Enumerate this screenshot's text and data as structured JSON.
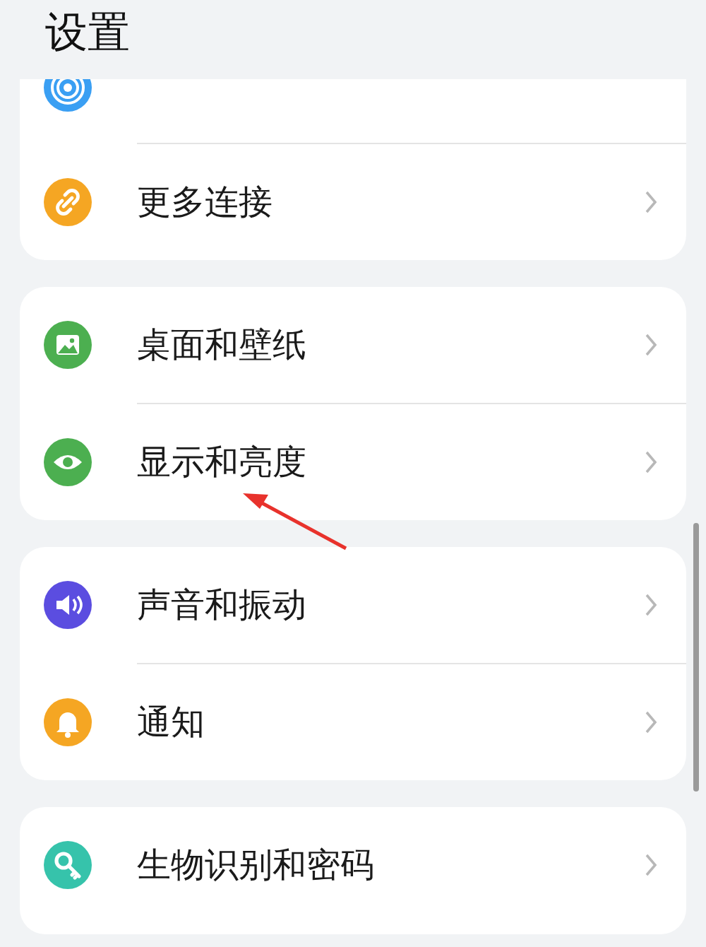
{
  "header": {
    "title": "设置"
  },
  "groups": [
    {
      "items": [
        {
          "kind": "signal",
          "color": "#3a9ff3"
        },
        {
          "label": "更多连接",
          "kind": "link",
          "color": "#f5a623"
        }
      ]
    },
    {
      "items": [
        {
          "label": "桌面和壁纸",
          "kind": "image",
          "color": "#4caf50"
        },
        {
          "label": "显示和亮度",
          "kind": "eye",
          "color": "#4caf50"
        }
      ]
    },
    {
      "items": [
        {
          "label": "声音和振动",
          "kind": "speaker",
          "color": "#5b4de0"
        },
        {
          "label": "通知",
          "kind": "bell",
          "color": "#f5a623"
        }
      ]
    },
    {
      "items": [
        {
          "label": "生物识别和密码",
          "kind": "key",
          "color": "#36c3ab"
        }
      ]
    }
  ]
}
